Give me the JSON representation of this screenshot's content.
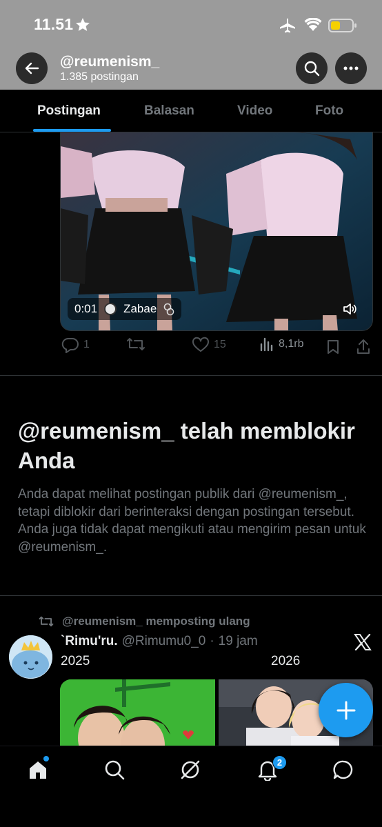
{
  "status_bar": {
    "time": "11.51"
  },
  "header": {
    "profile_name": "@reumenism_",
    "post_count": "1.385 postingan"
  },
  "tabs": [
    {
      "label": "Postingan",
      "active": true
    },
    {
      "label": "Balasan",
      "active": false
    },
    {
      "label": "Video",
      "active": false
    },
    {
      "label": "Foto",
      "active": false
    }
  ],
  "video": {
    "timestamp": "0:01",
    "channel": "Zabae"
  },
  "actions": {
    "replies": "1",
    "reposts": "",
    "likes": "15",
    "views": "8,1rb"
  },
  "blocked": {
    "title": "@reumenism_ telah memblokir Anda",
    "text": "Anda dapat melihat postingan publik dari @reumenism_, tetapi diblokir dari berinteraksi dengan postingan tersebut. Anda juga tidak dapat mengikuti atau mengirim pesan untuk @reumenism_."
  },
  "repost": {
    "label": "@reumenism_ memposting ulang",
    "author_name": "`Rimu'ru.",
    "author_handle": "@Rimumu0_0",
    "separator": "·",
    "time": "19 jam",
    "text_left": "2025",
    "text_right": "2026"
  },
  "bottom_nav": {
    "notification_count": "2"
  },
  "colors": {
    "accent": "#1d9bf0",
    "header_bg": "#9b9b9b",
    "muted": "#71767b"
  }
}
